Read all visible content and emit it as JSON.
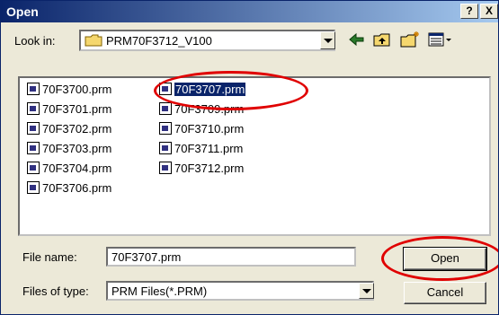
{
  "window": {
    "title": "Open",
    "help_label": "?",
    "close_label": "X"
  },
  "lookin": {
    "label": "Look in:",
    "value": "PRM70F3712_V100"
  },
  "toolbar": {
    "back_icon": "back-arrow-icon",
    "up_icon": "up-folder-icon",
    "new_folder_icon": "new-folder-icon",
    "view_icon": "view-menu-icon"
  },
  "files": [
    {
      "name": "70F3700.prm"
    },
    {
      "name": "70F3701.prm"
    },
    {
      "name": "70F3702.prm"
    },
    {
      "name": "70F3703.prm"
    },
    {
      "name": "70F3704.prm"
    },
    {
      "name": "70F3706.prm"
    },
    {
      "name": "70F3707.prm",
      "selected": true
    },
    {
      "name": "70F3709.prm"
    },
    {
      "name": "70F3710.prm"
    },
    {
      "name": "70F3711.prm"
    },
    {
      "name": "70F3712.prm"
    }
  ],
  "filename": {
    "label": "File name:",
    "value": "70F3707.prm"
  },
  "filetype": {
    "label": "Files of type:",
    "value": "PRM Files(*.PRM)"
  },
  "buttons": {
    "open": "Open",
    "cancel": "Cancel"
  },
  "colors": {
    "titlebar": "#0a246a",
    "selection": "#0a246a",
    "annotation": "#e00000",
    "dialog_bg": "#ece9d8"
  }
}
